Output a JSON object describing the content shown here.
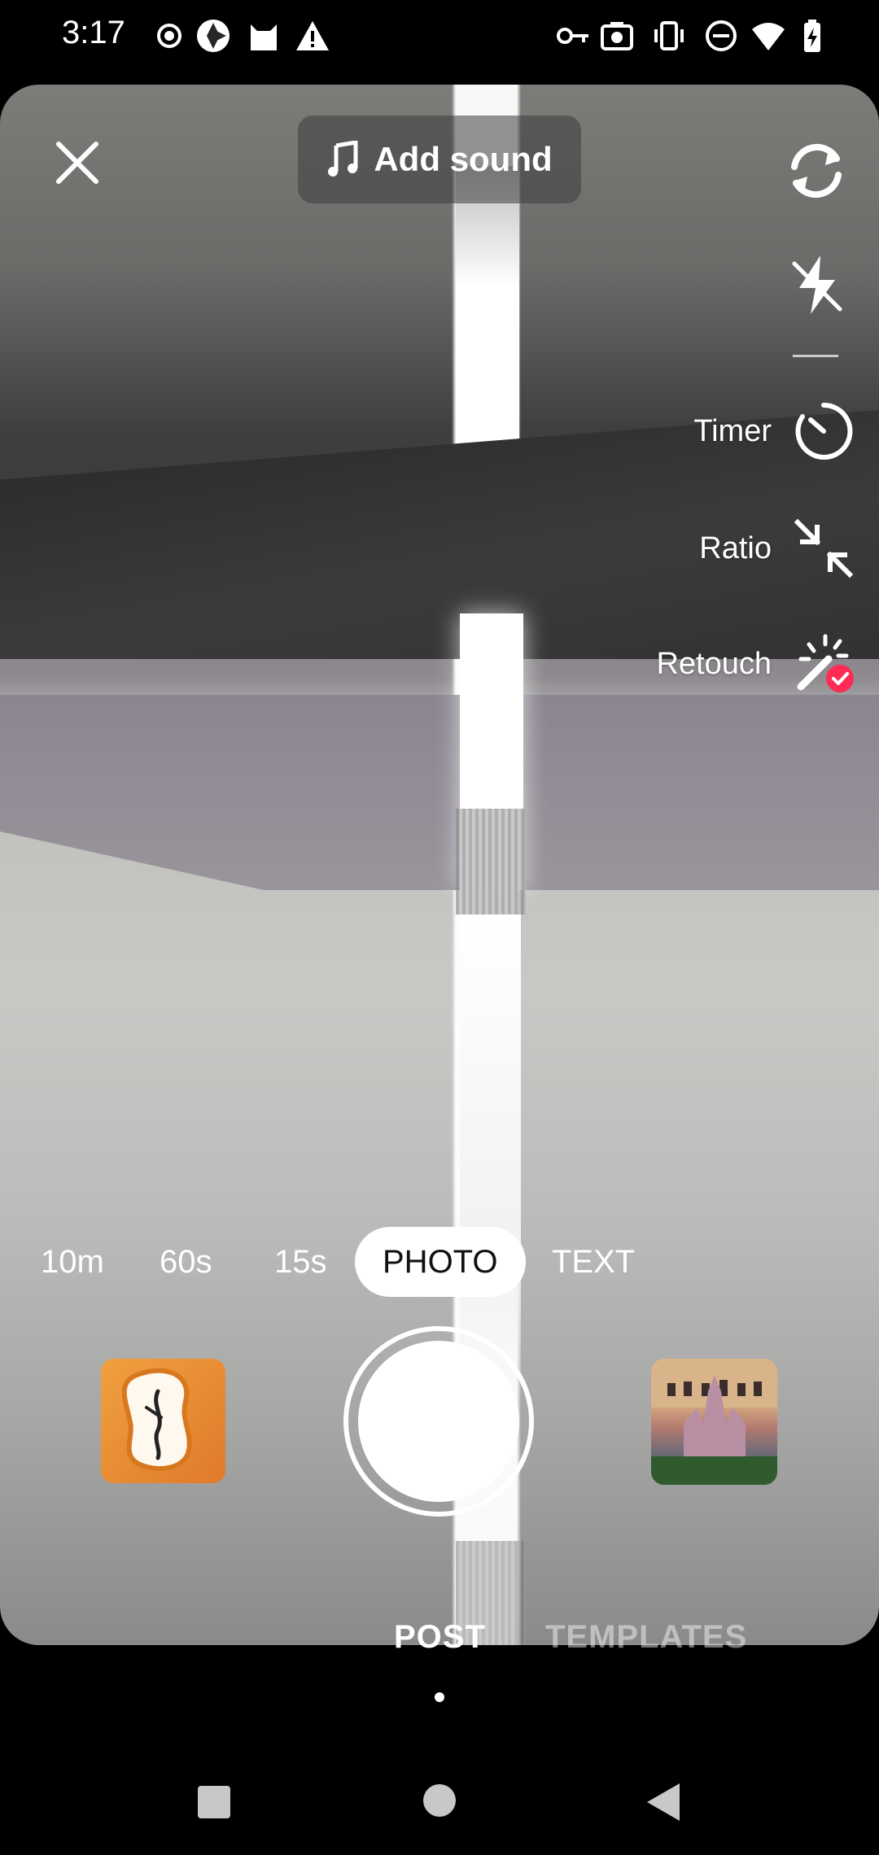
{
  "status_bar": {
    "time": "3:17",
    "left_icons": [
      "record-icon",
      "shutter-app-icon",
      "cat-icon",
      "warning-icon"
    ],
    "right_icons": [
      "key-icon",
      "screenshot-icon",
      "vibrate-icon",
      "dnd-icon",
      "wifi-icon",
      "battery-charging-icon"
    ]
  },
  "top_bar": {
    "close_icon": "close-icon",
    "add_sound_label": "Add sound",
    "music_icon": "music-note-icon",
    "flip_icon": "flip-camera-icon"
  },
  "side_tools": {
    "flash_icon": "flash-off-icon",
    "timer_label": "Timer",
    "ratio_label": "Ratio",
    "retouch_label": "Retouch"
  },
  "modes": [
    "10m",
    "60s",
    "15s",
    "PHOTO",
    "TEXT"
  ],
  "active_mode": "PHOTO",
  "bottom_tabs": {
    "post": "POST",
    "templates": "TEMPLATES"
  },
  "colors": {
    "accent_red": "#fe2c55",
    "background": "#000000"
  }
}
